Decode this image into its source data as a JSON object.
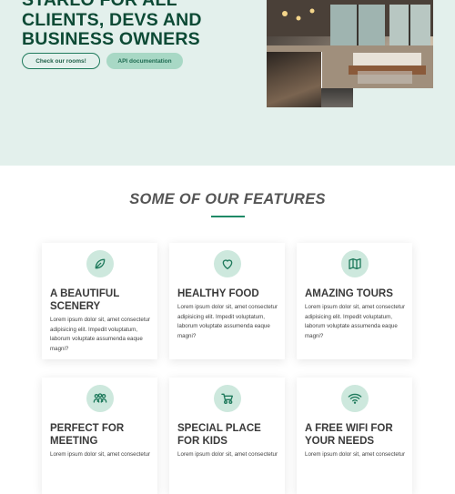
{
  "hero": {
    "title_lines": [
      "STARLO FOR ALL",
      "CLIENTS, DEVS AND",
      "BUSINESS OWNERS"
    ],
    "button_rooms": "Check our rooms!",
    "button_api": "API documentation"
  },
  "features": {
    "title": "SOME OF OUR FEATURES",
    "cards": [
      {
        "title": "A BEAUTIFUL SCENERY",
        "text": "Lorem ipsum dolor sit, amet consectetur adipisicing elit. Impedit voluptatum, laborum voluptate assumenda eaque magni?",
        "icon": "leaf-icon"
      },
      {
        "title": "HEALTHY FOOD",
        "text": "Lorem ipsum dolor sit, amet consectetur adipisicing elit. Impedit voluptatum, laborum voluptate assumenda eaque magni?",
        "icon": "heart-icon"
      },
      {
        "title": "AMAZING TOURS",
        "text": "Lorem ipsum dolor sit, amet consectetur adipisicing elit. Impedit voluptatum, laborum voluptate assumenda eaque magni?",
        "icon": "map-icon"
      },
      {
        "title": "PERFECT FOR MEETING",
        "text": "Lorem ipsum dolor sit, amet consectetur",
        "icon": "people-icon"
      },
      {
        "title": "SPECIAL PLACE FOR KIDS",
        "text": "Lorem ipsum dolor sit, amet consectetur",
        "icon": "stroller-icon"
      },
      {
        "title": "A FREE WIFI FOR YOUR NEEDS",
        "text": "Lorem ipsum dolor sit, amet consectetur",
        "icon": "wifi-icon"
      }
    ]
  },
  "colors": {
    "accent": "#1f8a66",
    "hero_bg": "#e3f0ec",
    "icon_bg": "#cde8dd"
  }
}
